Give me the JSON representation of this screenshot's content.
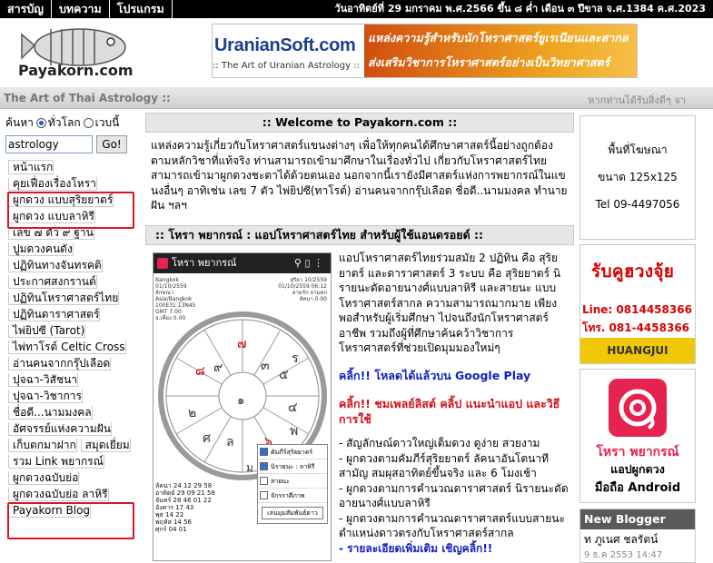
{
  "topbar": {
    "nav": [
      "สารบัญ",
      "บทความ",
      "โปรแกรม"
    ],
    "date": "วันอาทิตย์ที่ 29 มกราคม พ.ศ.2566 ขึ้น ๘ ค่ำ เดือน ๓ ปีขาล จ.ศ.1384 ค.ศ.2023"
  },
  "header": {
    "logo_text": "Payakorn.com",
    "banner_brand": "UranianSoft.com",
    "banner_tagline": ":: The Art of Uranian Astrology ::",
    "banner_line1": "แหล่งความรู้สำหรับนักโหราศาสตร์ยูเรเนียนและสากล",
    "banner_line2": "ส่งเสริมวิชาการโหราศาสตร์อย่างเป็นวิทยาศาสตร์"
  },
  "strip": {
    "left": "The Art of Thai Astrology ::",
    "right": "หากท่านได้รับสิ่งดีๆ จา"
  },
  "search": {
    "label": "ค้นหา",
    "opt_world": "ทั่วโลก",
    "opt_web": "เวบนี้",
    "value": "astrology",
    "go": "Go!"
  },
  "menu": [
    "หน้าแรก",
    "คุยเฟื่องเรื่องโหรา",
    "ผูกดวง แบบสุริยยาตร์",
    "ผูกดวง แบบลาหิรี",
    "เลข ๗ ตัว ๙ ฐาน",
    "ปูมดวงคนดัง",
    "ปฏิทินทางจันทรคติ",
    "ประกาศสงกรานต์",
    "ปฏิทินโหราศาสตร์ไทย",
    "ปฏิทินดาราศาสตร์",
    "ไพ่ยิปซี (Tarot)",
    "ไพ่ทาโรต์ Celtic Cross",
    "อ่านคนจากกรุ๊ปเลือด",
    "ปุจฉา-วิสัชนา",
    "ปุจฉา-วิชาการ",
    "ชื่อดี...นามมงคล",
    "อัศจรรย์แห่งความฝัน",
    "เก็บตกมาฝาก",
    "สมุดเยี่ยม",
    "รวม Link พยากรณ์",
    "ผูกดวงฉบับย่อ",
    "ผูกดวงฉบับย่อ ลาหิรี",
    "Payakorn Blog"
  ],
  "welcome": {
    "title": ":: Welcome to Payakorn.com ::",
    "body": "แหล่งความรู้เกี่ยวกับโหราศาสตร์แขนงต่างๆ เพื่อให้ทุกคนได้ศึกษาศาสตร์นี้อย่างถูกต้อง ตามหลักวิชาที่แท้จริง ท่านสามารถเข้ามาศึกษาในเรื่องทั่วไป เกี่ยวกับโหราศาสตร์ไทย สามารถเข้ามาผูกดวงชะตาได้ด้วยตนเอง นอกจากนี้เรายังมีศาสตร์แห่งการพยากรณ์ในแขนงอื่นๆ อาทิเช่น เลข 7 ตัว ไพ่ยิปซี(ทาโรต์) อ่านคนจากกรุ๊ปเลือด ชื่อดี..นามมงคล ทำนายฝัน ฯลฯ"
  },
  "app_section": {
    "title": ":: โหรา พยากรณ์ : แอปโหราศาสตร์ไทย สำหรับผู้ใช้แอนดรอยด์ ::",
    "intro": "แอปโหราศาสตร์ไทยร่วมสมัย 2 ปฏิทิน คือ สุริยยาตร์ และดาราศาสตร์ 3 ระบบ คือ สุริยยาตร์ นิรายนะดัดอายนางศ์แบบลาหิรี และสายนะ แบบโหราศาสตร์สากล ความสามารถมากมาย เพียงพอสำหรับผู้เริ่มศึกษา ไปจนถึงนักโหราศาสตร์อาชีพ รวมถึงผู้ที่ศึกษาค้นคว้าวิชาการโหราศาสตร์ที่ช่วยเปิดมุมมองใหม่ๆ",
    "link_download": "คลิ้ก!! โหลดได้แล้วบน Google Play",
    "link_clip": "คลิ้ก!! ชมเพลย์ลิสต์ คลิ้ป แนะนำแอป และวิธีการใช้",
    "bullets": [
      "- สัญลักษณ์ดาวใหญ่เต็มดวง ดูง่าย สวยงาม",
      "- ผูกดวงตามคัมภีร์สุริยยาตร์ ลัคนาอันโตนาที สามัญ สมผุสอาทิตย์ขึ้นจริง และ 6 โมงเช้า",
      "- ผูกดวงตามการคำนวณดาราศาสตร์ นิรายนะดัดอายนางศ์แบบลาหิรี",
      "- ผูกดวงตามการคำนวณดาราศาสตร์แบบสายนะ ตำแหน่งดาวตรงกับโหราศาสตร์สากล"
    ],
    "more": "- รายละเอียดเพิ่มเติม เชิญคลิ้ก!!",
    "phone": {
      "app_title": "โหรา พยากรณ์",
      "info_left": [
        "Bangkok",
        "01/10/2559",
        "ลักขณา",
        "Asia/Bangkok",
        "100E31 13N45",
        "GMT 7.00",
        "จ.เที่ยง 0.00"
      ],
      "info_right": [
        "สุริยา 10/2559",
        "01/10/2559 06:12",
        "ยามรัก ยามตก",
        "ลัคนา 0.00"
      ],
      "houses": [
        "๗",
        "๙",
        "๘",
        "๓",
        "๕",
        "๑",
        "๒",
        "๔",
        "๖",
        "ล",
        "พ",
        "ศ",
        "ร",
        "ม"
      ],
      "table": [
        "ลัคนา 24 12   29 58",
        "อาทิตย์ 29 09  21 58",
        "จันทร์ 28 46   01 22",
        "อังคาร 17 43",
        "พุธ 14 22",
        "พฤหัส 14 56",
        "ศุกร์ 04 01"
      ],
      "popup_items": [
        "คัมภีร์สุริยยาตร์",
        "นิรายนะ : ลาหิรี",
        "สายนะ",
        "จักรราศีภาพ"
      ],
      "popup_button": "เล่นมุมสัมพันธ์ดาว"
    }
  },
  "right": {
    "ad_line1": "พื้นที่โฆษณา",
    "ad_line2": "ขนาด 125x125",
    "ad_line3": "Tel 09-4497056",
    "rub_title": "รับคูฮวงจุ้ย",
    "rub_line": "Line: 0814458366",
    "rub_tel": "โทร. 081-4458366",
    "rub_brand": "HUANGJUI",
    "app_title": "โหรา พยากรณ์",
    "app_sub1": "แอปผูกดวง",
    "app_sub2": "มือถือ Android",
    "newblog_title": "New Blogger",
    "newblog_item": "ท ภูเนศ ชลรัตน์",
    "newblog_date": "9 ธ.ค 2553 14:47"
  }
}
